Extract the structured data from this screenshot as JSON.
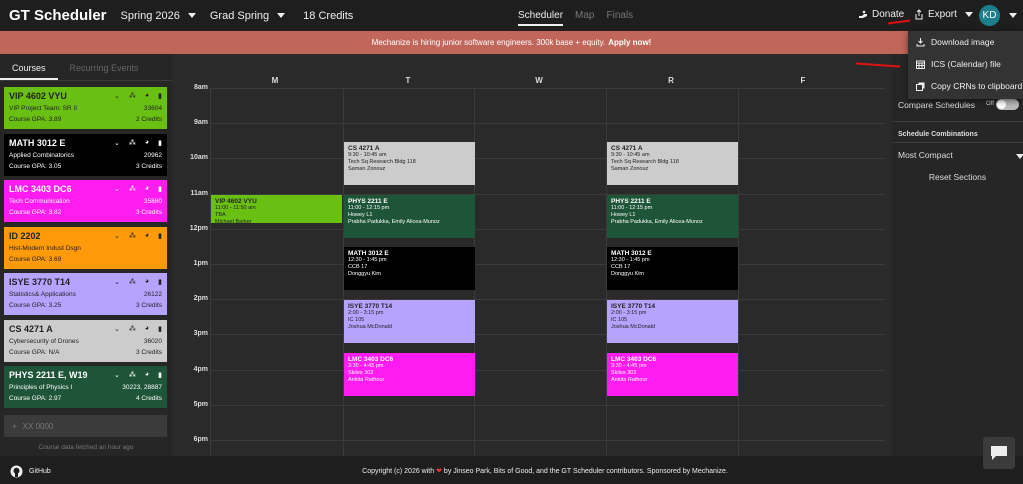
{
  "header": {
    "logo": "GT Scheduler",
    "term": "Spring 2026",
    "version": "Grad Spring",
    "credits": "18 Credits",
    "tabs": [
      "Scheduler",
      "Map",
      "Finals"
    ],
    "donate": "Donate",
    "export": "Export",
    "avatar": "KD"
  },
  "banner": {
    "text": "Mechanize is hiring junior software engineers. 300k base + equity.",
    "link": "Apply now!"
  },
  "sidebar": {
    "tabs": [
      "Courses",
      "Recurring Events"
    ],
    "courses": [
      {
        "name": "VIP 4602 VYU",
        "title": "VIP Project Team: SR II",
        "crn": "33604",
        "gpa": "Course GPA: 3.89",
        "credits": "2 Credits",
        "color": "#6abf13",
        "text": "#222"
      },
      {
        "name": "MATH 3012 E",
        "title": "Applied Combinatorics",
        "crn": "20962",
        "gpa": "Course GPA: 3.05",
        "credits": "3 Credits",
        "color": "#000000",
        "text": "#fff"
      },
      {
        "name": "LMC 3403 DC6",
        "title": "Tech Communication",
        "crn": "35880",
        "gpa": "Course GPA: 3.82",
        "credits": "3 Credits",
        "color": "#ff1cf0",
        "text": "#fff"
      },
      {
        "name": "ID 2202",
        "title": "Hist-Modern Indust Dsgn",
        "crn": "",
        "gpa": "Course GPA: 3.69",
        "credits": "",
        "color": "#ff9a0a",
        "text": "#222"
      },
      {
        "name": "ISYE 3770 T14",
        "title": "Statistics& Applications",
        "crn": "26122",
        "gpa": "Course GPA: 3.25",
        "credits": "3 Credits",
        "color": "#b6a3ff",
        "text": "#222"
      },
      {
        "name": "CS 4271 A",
        "title": "Cybersecurity of Drones",
        "crn": "36020",
        "gpa": "Course GPA: N/A",
        "credits": "3 Credits",
        "color": "#cccccc",
        "text": "#222"
      },
      {
        "name": "PHYS 2211 E, W19",
        "title": "Principles of Physics I",
        "crn": "30223, 28887",
        "gpa": "Course GPA: 2.97",
        "credits": "4 Credits",
        "color": "#1e5539",
        "text": "#fff"
      }
    ],
    "add_placeholder": "XX 0000",
    "fetched": "Course data fetched an hour ago"
  },
  "calendar": {
    "days": [
      "M",
      "T",
      "W",
      "R",
      "F"
    ],
    "times": [
      "8am",
      "9am",
      "10am",
      "11am",
      "12pm",
      "1pm",
      "2pm",
      "3pm",
      "4pm",
      "5pm",
      "6pm"
    ],
    "events": [
      {
        "day": 0,
        "start": 11.0,
        "end": 11.833,
        "title": "VIP 4602 VYU",
        "time": "11:00 - 11:50 am",
        "loc": "TBA",
        "prof": "Michael Barker",
        "color": "#6abf13",
        "text": "#222"
      },
      {
        "day": 1,
        "start": 9.5,
        "end": 10.75,
        "title": "CS 4271 A",
        "time": "9:30 - 10:45 am",
        "loc": "Tech Sq Research Bldg 118",
        "prof": "Saman Zonouz",
        "color": "#cccccc",
        "text": "#222"
      },
      {
        "day": 3,
        "start": 9.5,
        "end": 10.75,
        "title": "CS 4271 A",
        "time": "9:30 - 10:45 am",
        "loc": "Tech Sq Research Bldg 118",
        "prof": "Saman Zonouz",
        "color": "#cccccc",
        "text": "#222"
      },
      {
        "day": 1,
        "start": 11.0,
        "end": 12.25,
        "title": "PHYS 2211 E",
        "time": "11:00 - 12:15 pm",
        "loc": "Howey L1",
        "prof": "Prabha Padukka, Emily Alicea-Munoz",
        "color": "#1e5539",
        "text": "#fff"
      },
      {
        "day": 3,
        "start": 11.0,
        "end": 12.25,
        "title": "PHYS 2211 E",
        "time": "11:00 - 12:15 pm",
        "loc": "Howey L1",
        "prof": "Prabha Padukka, Emily Alicea-Munoz",
        "color": "#1e5539",
        "text": "#fff"
      },
      {
        "day": 1,
        "start": 12.5,
        "end": 13.75,
        "title": "MATH 3012 E",
        "time": "12:30 - 1:45 pm",
        "loc": "CCB 17",
        "prof": "Donggyu Kim",
        "color": "#000000",
        "text": "#fff"
      },
      {
        "day": 3,
        "start": 12.5,
        "end": 13.75,
        "title": "MATH 3012 E",
        "time": "12:30 - 1:45 pm",
        "loc": "CCB 17",
        "prof": "Donggyu Kim",
        "color": "#000000",
        "text": "#fff"
      },
      {
        "day": 1,
        "start": 14.0,
        "end": 15.25,
        "title": "ISYE 3770 T14",
        "time": "2:00 - 3:15 pm",
        "loc": "IC 105",
        "prof": "Joshua McDonald",
        "color": "#b6a3ff",
        "text": "#222"
      },
      {
        "day": 3,
        "start": 14.0,
        "end": 15.25,
        "title": "ISYE 3770 T14",
        "time": "2:00 - 3:15 pm",
        "loc": "IC 105",
        "prof": "Joshua McDonald",
        "color": "#b6a3ff",
        "text": "#222"
      },
      {
        "day": 1,
        "start": 15.5,
        "end": 16.75,
        "title": "LMC 3403 DC6",
        "time": "3:30 - 4:45 pm",
        "loc": "Skiles 302",
        "prof": "Ankita Rathour",
        "color": "#ff1cf0",
        "text": "#fff"
      },
      {
        "day": 3,
        "start": 15.5,
        "end": 16.75,
        "title": "LMC 3403 DC6",
        "time": "3:30 - 4:45 pm",
        "loc": "Skiles 302",
        "prof": "Ankita Rathour",
        "color": "#ff1cf0",
        "text": "#fff"
      }
    ]
  },
  "right_panel": {
    "compare": "Compare Schedules",
    "off": "Off",
    "combinations": "Schedule Combinations",
    "sort": "Most Compact",
    "reset": "Reset Sections"
  },
  "export_menu": {
    "items": [
      "Download image",
      "ICS (Calendar) file",
      "Copy CRNs to clipboard"
    ]
  },
  "footer": {
    "github": "GitHub",
    "copyright": "Copyright (c) 2026 with",
    "copyright2": "by Jinseo Park, Bits of Good, and the GT Scheduler contributors. Sponsored by Mechanize."
  }
}
